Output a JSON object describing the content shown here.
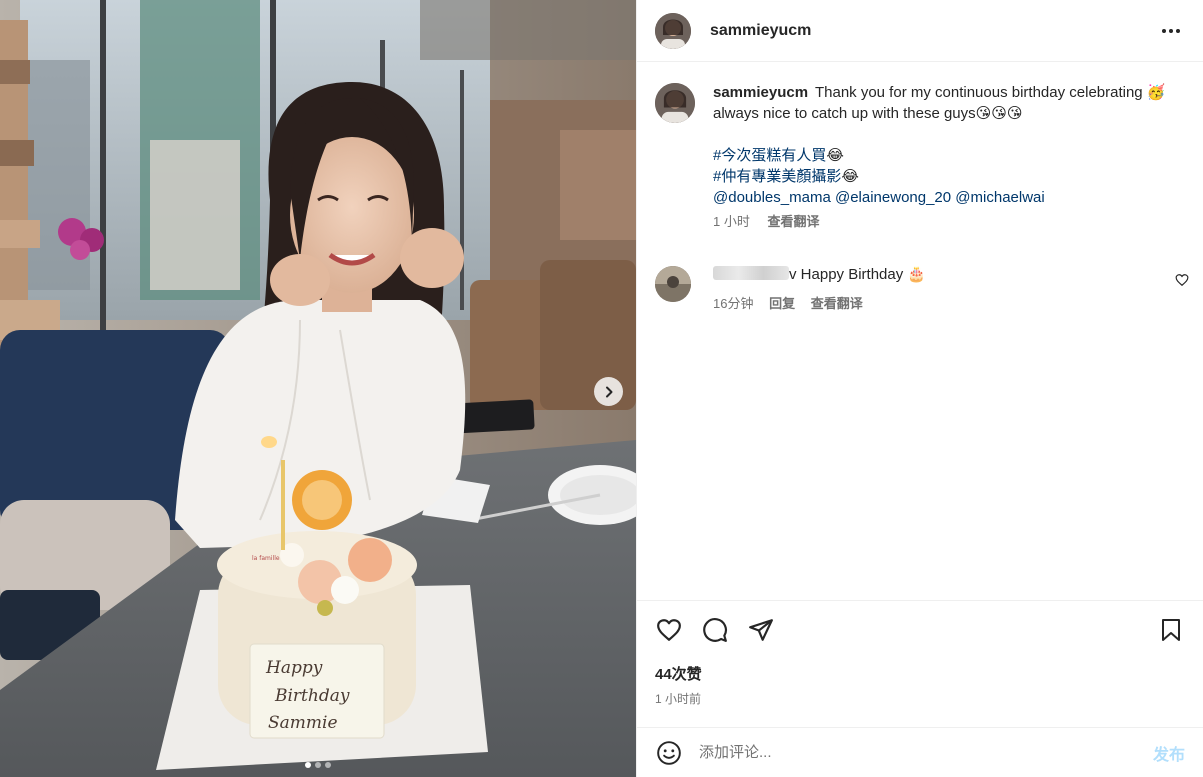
{
  "post": {
    "username": "sammieyucm",
    "caption": {
      "line1": "Thank you for my continuous birthday celebrating",
      "emoji1": "🥳",
      "line2": "always nice to catch up with these guys",
      "emoji2": "😘😘😘",
      "hashtag1": "#今次蛋糕有人買",
      "hashtag1_emoji": "😂",
      "hashtag2": "#仲有專業美顏攝影",
      "hashtag2_emoji": "😂",
      "mention1": "@doubles_mama",
      "mention2": "@elainewong_20",
      "mention3": "@michaelwai",
      "time": "1 小时",
      "translate": "查看翻译"
    },
    "comment": {
      "name_tail": "v",
      "text": "Happy Birthday",
      "emoji": "🎂",
      "time": "16分钟",
      "reply": "回复",
      "translate": "查看翻译"
    },
    "likes": "44次赞",
    "posted_ago": "1 小时前",
    "add_comment_placeholder": "添加评论...",
    "post_button": "发布"
  },
  "photo": {
    "cake_plaque": [
      "Happy",
      "Birthday",
      "Sammie"
    ],
    "cake_brand": "la famille",
    "carousel": {
      "count": 3,
      "active": 0
    }
  },
  "icons": {
    "more": "more-options-icon",
    "like": "heart-icon",
    "comment": "comment-bubble-icon",
    "share": "paper-plane-icon",
    "save": "bookmark-icon",
    "emoji": "smiley-icon",
    "next": "chevron-right-icon"
  },
  "colors": {
    "link": "#00376b",
    "meta": "#737373",
    "post_button_disabled": "#b2dffc"
  }
}
